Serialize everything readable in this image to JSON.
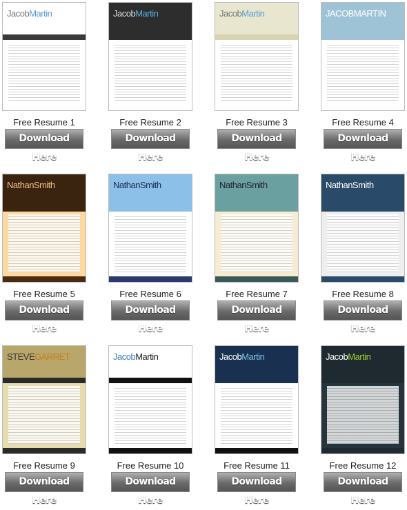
{
  "button_label": "Download Here",
  "resumes": [
    {
      "label": "Free Resume 1",
      "name1": "Jacob",
      "name2": "Martin",
      "hdr": "#ffffff",
      "c1": "#777",
      "c2": "#5b9bd5",
      "band": "#3a3a3a",
      "foot": "#fff",
      "body": "#fff"
    },
    {
      "label": "Free Resume 2",
      "name1": "Jacob",
      "name2": "Martin",
      "hdr": "#2d2d2d",
      "c1": "#ddd",
      "c2": "#5aaee0",
      "band": "#2d2d2d",
      "foot": "#fff",
      "body": "#fff"
    },
    {
      "label": "Free Resume 3",
      "name1": "Jacob",
      "name2": "Martin",
      "hdr": "#e8e6cf",
      "c1": "#777",
      "c2": "#5b9bd5",
      "band": "#d8d4b0",
      "foot": "#fff",
      "body": "#fff"
    },
    {
      "label": "Free Resume 4",
      "name1": "JACOB",
      "name2": "MARTIN",
      "hdr": "#9fc3d6",
      "c1": "#fff",
      "c2": "#fff",
      "band": "#9fc3d6",
      "foot": "#fff",
      "body": "#fff"
    },
    {
      "label": "Free Resume 5",
      "name1": "Nathan",
      "name2": "Smith",
      "hdr": "#3a2410",
      "c1": "#f0c080",
      "c2": "#f0c080",
      "band": "#3a2410",
      "foot": "#4a2a10",
      "body": "#fbd9a0"
    },
    {
      "label": "Free Resume 6",
      "name1": "Nathan",
      "name2": "Smith",
      "hdr": "#8cc0e8",
      "c1": "#1a2a50",
      "c2": "#1a2a50",
      "band": "#8cc0e8",
      "foot": "#2a3a6a",
      "body": "#fff"
    },
    {
      "label": "Free Resume 7",
      "name1": "Nathan",
      "name2": "Smith",
      "hdr": "#6aa0a0",
      "c1": "#223",
      "c2": "#223",
      "band": "#6aa0a0",
      "foot": "#3a5a5a",
      "body": "#f6eccf"
    },
    {
      "label": "Free Resume 8",
      "name1": "Nathan",
      "name2": "Smith",
      "hdr": "#2a4a6a",
      "c1": "#fff",
      "c2": "#fff",
      "band": "#2a4a6a",
      "foot": "#2a4a6a",
      "body": "#eee"
    },
    {
      "label": "Free Resume 9",
      "name1": "STEVE",
      "name2": "GARRET",
      "hdr": "#b8a66a",
      "c1": "#333",
      "c2": "#c08020",
      "band": "#2a2a2a",
      "foot": "#2a2a2a",
      "body": "#e6dcb0"
    },
    {
      "label": "Free Resume 10",
      "name1": "Jacob",
      "name2": "Martin",
      "hdr": "#ffffff",
      "c1": "#3a80c0",
      "c2": "#222",
      "band": "#111",
      "foot": "#111",
      "body": "#fff"
    },
    {
      "label": "Free Resume 11",
      "name1": "Jacob",
      "name2": "Martin",
      "hdr": "#1a3050",
      "c1": "#fff",
      "c2": "#7ac0e8",
      "band": "#1a3050",
      "foot": "#111",
      "body": "#fff"
    },
    {
      "label": "Free Resume 12",
      "name1": "Jacob",
      "name2": "Martin",
      "hdr": "#1e2a30",
      "c1": "#fff",
      "c2": "#9c3",
      "band": "#1e2a30",
      "foot": "#1e2a30",
      "body": "#25353d"
    }
  ]
}
